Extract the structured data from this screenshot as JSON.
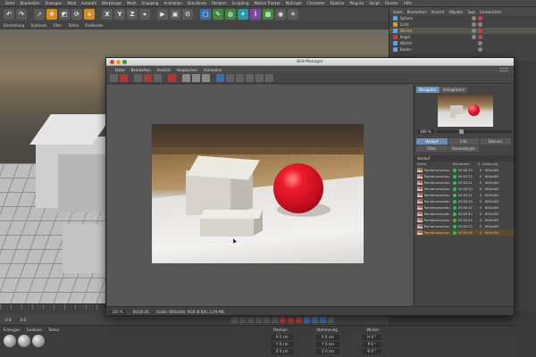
{
  "app": {
    "menu": [
      "Datei",
      "Bearbeiten",
      "Erzeugen",
      "Modi",
      "Auswahl",
      "Werkzeuge",
      "Mesh",
      "Snapping",
      "Animation",
      "Simulieren",
      "Rendern",
      "Sculpting",
      "Motion Tracker",
      "MoGraph",
      "Charakter",
      "Pipeline",
      "Plug-ins",
      "Skript",
      "Fenster",
      "Hilfe"
    ],
    "viewport_menu": [
      "Darstellung",
      "Optionen",
      "Filter",
      "Tafeln",
      "ProRender"
    ]
  },
  "toolbar": {
    "axis_x": "X",
    "axis_y": "Y",
    "axis_z": "Z"
  },
  "object_manager": {
    "menu": [
      "Datei",
      "Bearbeiten",
      "Ansicht",
      "Objekte",
      "Tags",
      "Lesezeichen"
    ],
    "objects": [
      {
        "name": "Sphere"
      },
      {
        "name": "Licht"
      },
      {
        "name": "Würfel"
      },
      {
        "name": "Kugel"
      },
      {
        "name": "Würfel"
      },
      {
        "name": "Boden"
      }
    ]
  },
  "bild_manager": {
    "title": "Bild-Manager",
    "menu": [
      "Datei",
      "Bearbeiten",
      "Ansicht",
      "Vergleichen",
      "Animation"
    ],
    "tabs_top": [
      "Navigator",
      "Histogramm"
    ],
    "zoom": "100 %",
    "tabs_mid": [
      "Verlauf",
      "Info",
      "Ebenen",
      "Filter",
      "Stereoskopie"
    ],
    "history_title": "Verlauf",
    "list_columns": [
      "Name",
      "Renderzeit",
      "R",
      "Auflösung"
    ],
    "history": [
      {
        "name": "Rendervorschau",
        "time": "00:00:20",
        "r": "0",
        "res": "600x400"
      },
      {
        "name": "Rendervorschau",
        "time": "00:00:22",
        "r": "0",
        "res": "600x400"
      },
      {
        "name": "Rendervorschau",
        "time": "00:00:21",
        "r": "0",
        "res": "600x400"
      },
      {
        "name": "Rendervorschau",
        "time": "00:00:20",
        "r": "0",
        "res": "600x400"
      },
      {
        "name": "Rendervorschau",
        "time": "00:00:21",
        "r": "0",
        "res": "600x400"
      },
      {
        "name": "Rendervorschau",
        "time": "00:00:20",
        "r": "0",
        "res": "600x400"
      },
      {
        "name": "Rendervorschau",
        "time": "00:00:21",
        "r": "0",
        "res": "600x400"
      },
      {
        "name": "Rendervorschau",
        "time": "00:00:20",
        "r": "0",
        "res": "600x400"
      },
      {
        "name": "Rendervorschau",
        "time": "00:00:21",
        "r": "0",
        "res": "600x400"
      },
      {
        "name": "Rendervorschau",
        "time": "00:00:22",
        "r": "0",
        "res": "600x400"
      },
      {
        "name": "Rendervorschau",
        "time": "00:00:26",
        "r": "0",
        "res": "600x400"
      }
    ],
    "status_zoom": "100 %",
    "status_time": "00:00:26",
    "status_info": "Größe: 600x400, RGB (8 Bit), 2,49 MB"
  },
  "timeline": {
    "frame_start": "0 B",
    "frame_current": "0 B"
  },
  "materials": {
    "menu": [
      "Erzeugen",
      "Funktion",
      "Textur"
    ]
  },
  "coordinates": {
    "headers": [
      "Position",
      "Abmessung",
      "Winkel"
    ],
    "rows": [
      {
        "pos": "X  0 cm",
        "size": "X  0 cm",
        "angle": "H  0 °"
      },
      {
        "pos": "Y  0 cm",
        "size": "Y  0 cm",
        "angle": "P  0 °"
      },
      {
        "pos": "Z  0 cm",
        "size": "Z  0 cm",
        "angle": "B  0 °"
      }
    ]
  },
  "colors": {
    "accent": "#6a8cb8",
    "selection": "#f0c050",
    "sphere_red": "#ee1c2e"
  }
}
